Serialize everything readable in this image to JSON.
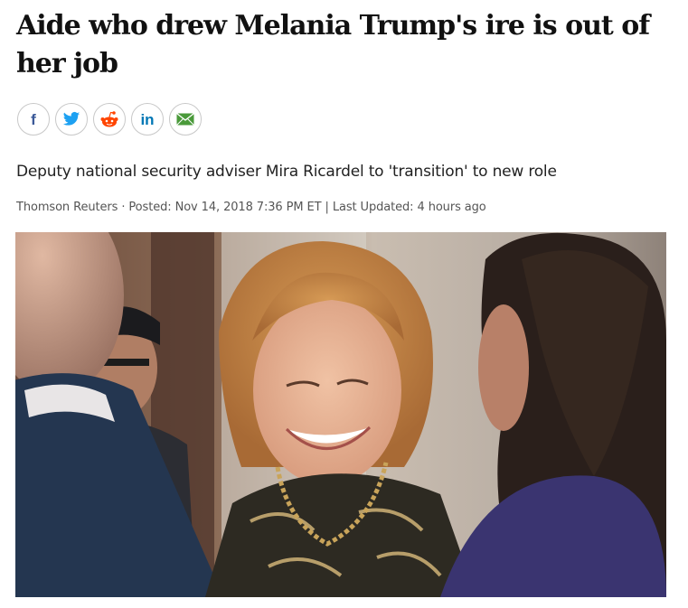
{
  "article": {
    "headline": "Aide who drew Melania Trump's ire is out of her job",
    "subheadline": "Deputy national security adviser Mira Ricardel to 'transition' to new role",
    "byline": {
      "source": "Thomson Reuters",
      "separator": " · ",
      "posted": "Posted: Nov 14, 2018 7:36 PM ET",
      "divider": " | ",
      "updated": "Last Updated: 4 hours ago"
    }
  },
  "share": {
    "items": [
      {
        "network": "facebook",
        "icon": "facebook-icon",
        "label": "f",
        "color": "#3b5998"
      },
      {
        "network": "twitter",
        "icon": "twitter-icon",
        "color": "#1da1f2"
      },
      {
        "network": "reddit",
        "icon": "reddit-icon",
        "color": "#ff4500"
      },
      {
        "network": "linkedin",
        "icon": "linkedin-icon",
        "label": "in",
        "color": "#0077b5"
      },
      {
        "network": "email",
        "icon": "email-icon",
        "color": "#4a9a3a"
      }
    ]
  },
  "photo": {
    "subject": "photograph-woman-smiling-at-event"
  }
}
